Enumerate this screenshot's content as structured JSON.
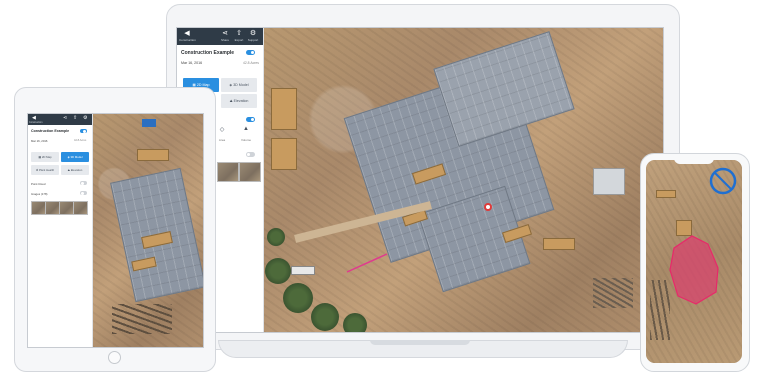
{
  "laptop_app": {
    "toolbar": {
      "back_label": "Construction",
      "share_label": "Share",
      "export_label": "Export",
      "support_label": "Support"
    },
    "project_title": "Construction Example",
    "date": "Mar 16, 2016",
    "subtitle": "42.8 Acres",
    "modes": {
      "map_2d": "2D Map",
      "model_3d": "3D Model",
      "elevation": "Elevation"
    },
    "measure_label": "Measurement",
    "tools": {
      "line_label": "Line",
      "area_label": "Area",
      "volume_label": "Volume"
    }
  },
  "tablet_app": {
    "back_label": "Construction",
    "project_title": "Construction Example",
    "date": "Mar 16, 2016",
    "subtitle": "42.8 Acres",
    "modes": {
      "map_2d": "2D Map",
      "model_3d": "3D Model",
      "plant_health": "Plant Health",
      "elevation": "Elevation"
    },
    "point_cloud_label": "Point Cloud",
    "images_label": "Images (178)"
  },
  "colors": {
    "accent": "#2a8fe0",
    "sidebar_header": "#2f3b47",
    "measure_line": "#e03a8f",
    "area_fill": "#d8436d"
  },
  "icons": {
    "back": "back-arrow-icon",
    "share": "share-icon",
    "export": "export-icon",
    "support": "gear-icon",
    "map_2d": "map-icon",
    "model_3d": "cube-icon",
    "elevation": "elevation-icon",
    "line": "line-tool-icon",
    "area": "area-tool-icon",
    "volume": "volume-tool-icon"
  }
}
